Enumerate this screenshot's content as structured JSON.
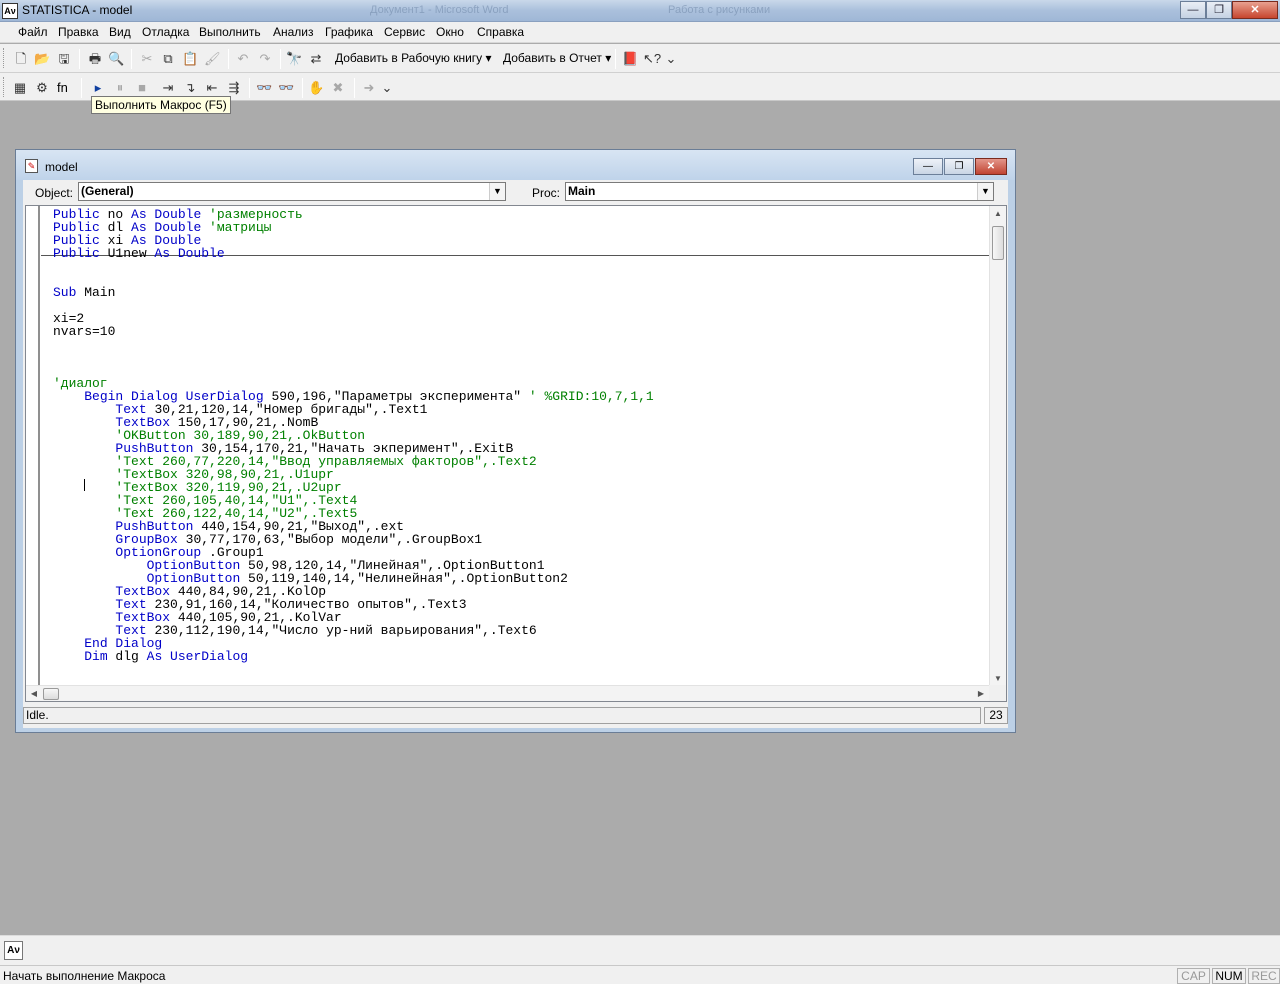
{
  "app": {
    "title": "STATISTICA - model",
    "icon_name": "statistica-app-icon",
    "ghost_titles": [
      "Документ1 - Microsoft Word",
      "Работа с рисунками"
    ]
  },
  "window_controls": {
    "minimize": "—",
    "maximize": "❐",
    "close": "✕"
  },
  "menu": [
    "Файл",
    "Правка",
    "Вид",
    "Отладка",
    "Выполнить",
    "Анализ",
    "Графика",
    "Сервис",
    "Окно",
    "Справка"
  ],
  "toolbar1": {
    "add_workbook": "Добавить в Рабочую книгу ▾",
    "add_report": "Добавить в Отчет ▾"
  },
  "toolbar2": {
    "fn_label": "fn"
  },
  "tooltip": "Выполнить Макрос (F5)",
  "model_window": {
    "title": "model",
    "object_label": "Object:",
    "object_value": "(General)",
    "proc_label": "Proc:",
    "proc_value": "Main",
    "status": "Idle.",
    "line_number": "23"
  },
  "code_lines": [
    [
      {
        "t": "Public",
        "c": "kw"
      },
      {
        "t": " no "
      },
      {
        "t": "As Double",
        "c": "kw"
      },
      {
        "t": " 'размерность",
        "c": "cm"
      }
    ],
    [
      {
        "t": "Public",
        "c": "kw"
      },
      {
        "t": " dl "
      },
      {
        "t": "As Double",
        "c": "kw"
      },
      {
        "t": " 'матрицы",
        "c": "cm"
      }
    ],
    [
      {
        "t": "Public",
        "c": "kw"
      },
      {
        "t": " xi "
      },
      {
        "t": "As Double",
        "c": "kw"
      }
    ],
    [
      {
        "t": "Public",
        "c": "kw"
      },
      {
        "t": " U1new "
      },
      {
        "t": "As Double",
        "c": "kw"
      }
    ],
    [],
    [],
    [
      {
        "t": "Sub",
        "c": "kw"
      },
      {
        "t": " Main"
      }
    ],
    [],
    [
      {
        "t": "xi=2"
      }
    ],
    [
      {
        "t": "nvars=10"
      }
    ],
    [],
    [],
    [],
    [
      {
        "t": "'диалог",
        "c": "cm"
      }
    ],
    [
      {
        "t": "    "
      },
      {
        "t": "Begin Dialog UserDialog",
        "c": "kw"
      },
      {
        "t": " 590,196,\"Параметры эксперимента\" "
      },
      {
        "t": "' %GRID:10,7,1,1",
        "c": "cm"
      }
    ],
    [
      {
        "t": "        "
      },
      {
        "t": "Text",
        "c": "kw"
      },
      {
        "t": " 30,21,120,14,\"Номер бригады\",.Text1"
      }
    ],
    [
      {
        "t": "        "
      },
      {
        "t": "TextBox",
        "c": "kw"
      },
      {
        "t": " 150,17,90,21,.NomB"
      }
    ],
    [
      {
        "t": "        "
      },
      {
        "t": "'OKButton 30,189,90,21,.OkButton",
        "c": "cm"
      }
    ],
    [
      {
        "t": "        "
      },
      {
        "t": "PushButton",
        "c": "kw"
      },
      {
        "t": " 30,154,170,21,\"Начать экперимент\",.ExitB"
      }
    ],
    [
      {
        "t": "        "
      },
      {
        "t": "'Text 260,77,220,14,\"Ввод управляемых факторов\",.Text2",
        "c": "cm"
      }
    ],
    [
      {
        "t": "        "
      },
      {
        "t": "'TextBox 320,98,90,21,.U1upr",
        "c": "cm"
      }
    ],
    [
      {
        "t": "        "
      },
      {
        "t": "'TextBox 320,119,90,21,.U2upr",
        "c": "cm"
      }
    ],
    [
      {
        "t": "        "
      },
      {
        "t": "'Text 260,105,40,14,\"U1\",.Text4",
        "c": "cm"
      }
    ],
    [
      {
        "t": "        "
      },
      {
        "t": "'Text 260,122,40,14,\"U2\",.Text5",
        "c": "cm"
      }
    ],
    [
      {
        "t": "        "
      },
      {
        "t": "PushButton",
        "c": "kw"
      },
      {
        "t": " 440,154,90,21,\"Выход\",.ext"
      }
    ],
    [
      {
        "t": "        "
      },
      {
        "t": "GroupBox",
        "c": "kw"
      },
      {
        "t": " 30,77,170,63,\"Выбор модели\",.GroupBox1"
      }
    ],
    [
      {
        "t": "        "
      },
      {
        "t": "OptionGroup",
        "c": "kw"
      },
      {
        "t": " .Group1"
      }
    ],
    [
      {
        "t": "            "
      },
      {
        "t": "OptionButton",
        "c": "kw"
      },
      {
        "t": " 50,98,120,14,\"Линейная\",.OptionButton1"
      }
    ],
    [
      {
        "t": "            "
      },
      {
        "t": "OptionButton",
        "c": "kw"
      },
      {
        "t": " 50,119,140,14,\"Нелинейная\",.OptionButton2"
      }
    ],
    [
      {
        "t": "        "
      },
      {
        "t": "TextBox",
        "c": "kw"
      },
      {
        "t": " 440,84,90,21,.KolOp"
      }
    ],
    [
      {
        "t": "        "
      },
      {
        "t": "Text",
        "c": "kw"
      },
      {
        "t": " 230,91,160,14,\"Количество опытов\",.Text3"
      }
    ],
    [
      {
        "t": "        "
      },
      {
        "t": "TextBox",
        "c": "kw"
      },
      {
        "t": " 440,105,90,21,.KolVar"
      }
    ],
    [
      {
        "t": "        "
      },
      {
        "t": "Text",
        "c": "kw"
      },
      {
        "t": " 230,112,190,14,\"Число ур-ний варьирования\",.Text6"
      }
    ],
    [
      {
        "t": "    "
      },
      {
        "t": "End Dialog",
        "c": "kw"
      }
    ],
    [
      {
        "t": "    "
      },
      {
        "t": "Dim",
        "c": "kw"
      },
      {
        "t": " dlg "
      },
      {
        "t": "As",
        "c": "kw"
      },
      {
        "t": " UserDialog",
        "c": "kw"
      }
    ]
  ],
  "statusbar": {
    "text": "Начать выполнение Макроса",
    "indicators": [
      {
        "label": "CAP",
        "active": false
      },
      {
        "label": "NUM",
        "active": true
      },
      {
        "label": "REC",
        "active": false
      }
    ]
  }
}
